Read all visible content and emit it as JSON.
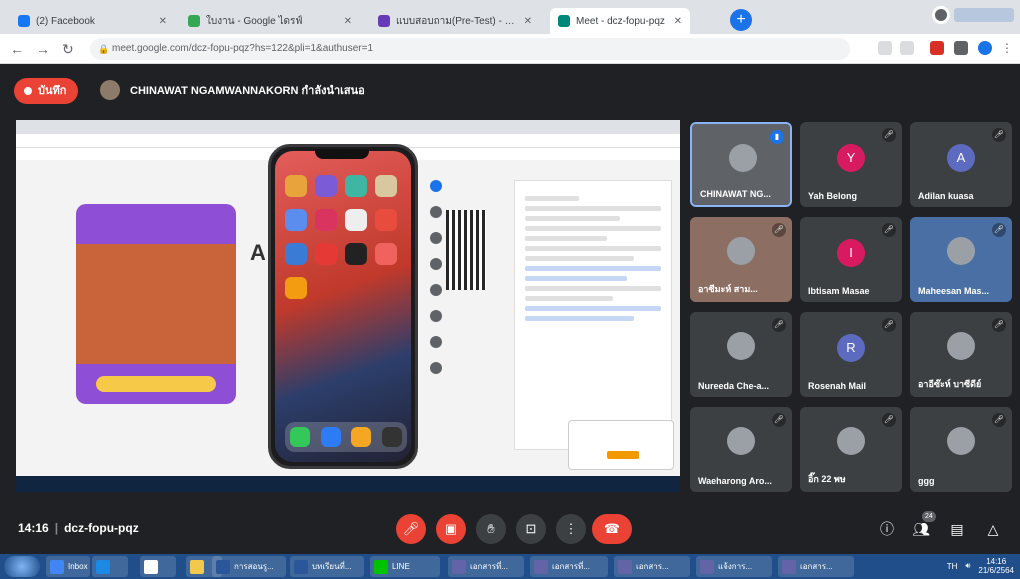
{
  "browser": {
    "tabs": [
      {
        "label": "(2) Facebook",
        "color": "#1877f2",
        "active": false
      },
      {
        "label": "ใบงาน - Google ไดรฟ์",
        "color": "#34a853",
        "active": false
      },
      {
        "label": "แบบสอบถาม(Pre-Test) - Google ฟ...",
        "color": "#673ab7",
        "active": false
      },
      {
        "label": "Meet - dcz-fopu-pqz",
        "color": "#00897b",
        "active": true
      }
    ],
    "url": "meet.google.com/dcz-fopu-pqz?hs=122&pli=1&authuser=1"
  },
  "meet": {
    "record_label": "บันทึก",
    "presenter_name": "CHINAWAT NGAMWANNAKORN กำลังนำเสนอ",
    "meeting_time": "14:16",
    "meeting_code": "dcz-fopu-pqz",
    "participants_count": "24",
    "tiles": [
      {
        "name": "CHINAWAT NG...",
        "kind": "photo",
        "color": "#5f6368",
        "mic": "on",
        "active": true
      },
      {
        "name": "Yah Belong",
        "kind": "letter",
        "letter": "Y",
        "color": "#d81b60",
        "mic": "muted"
      },
      {
        "name": "Adilan kuasa",
        "kind": "letter",
        "letter": "A",
        "color": "#5c6bc0",
        "mic": "muted"
      },
      {
        "name": "อาซีมะห์ สาม...",
        "kind": "photo",
        "color": "#8d6e63",
        "mic": "muted"
      },
      {
        "name": "Ibtisam Masae",
        "kind": "letter",
        "letter": "I",
        "color": "#d81b60",
        "mic": "muted"
      },
      {
        "name": "Maheesan Mas...",
        "kind": "photo",
        "color": "#4a6fa5",
        "mic": "muted"
      },
      {
        "name": "Nureeda Che-a...",
        "kind": "photo",
        "color": "#3c4043",
        "mic": "muted"
      },
      {
        "name": "Rosenah Mail",
        "kind": "letter",
        "letter": "R",
        "color": "#5c6bc0",
        "mic": "muted"
      },
      {
        "name": "อาอีซ๊ะห์ บาซีดีย์",
        "kind": "photo",
        "color": "#3c4043",
        "mic": "muted"
      },
      {
        "name": "Waeharong Aro...",
        "kind": "photo",
        "color": "#3c4043",
        "mic": "muted"
      },
      {
        "name": "อิ๊ก 22 พษ",
        "kind": "photo",
        "color": "#3c4043",
        "mic": "muted"
      },
      {
        "name": "ggg",
        "kind": "photo",
        "color": "#3c4043",
        "mic": "muted"
      }
    ]
  },
  "taskbar": {
    "items": [
      {
        "label": "Inbox - L...",
        "color": "#4285f4"
      },
      {
        "label": "การสอนรู...",
        "color": "#2b579a"
      },
      {
        "label": "บทเรียนที่...",
        "color": "#2b579a"
      },
      {
        "label": "LINE",
        "color": "#00c300"
      },
      {
        "label": "เอกสารที่...",
        "color": "#6264a7"
      },
      {
        "label": "เอกสารที่...",
        "color": "#6264a7"
      },
      {
        "label": "เอกสาร...",
        "color": "#6264a7"
      },
      {
        "label": "แจ้งการ...",
        "color": "#6264a7"
      },
      {
        "label": "เอกสาร...",
        "color": "#6264a7"
      }
    ],
    "lang": "TH",
    "time": "14:16",
    "date": "21/6/2564"
  }
}
